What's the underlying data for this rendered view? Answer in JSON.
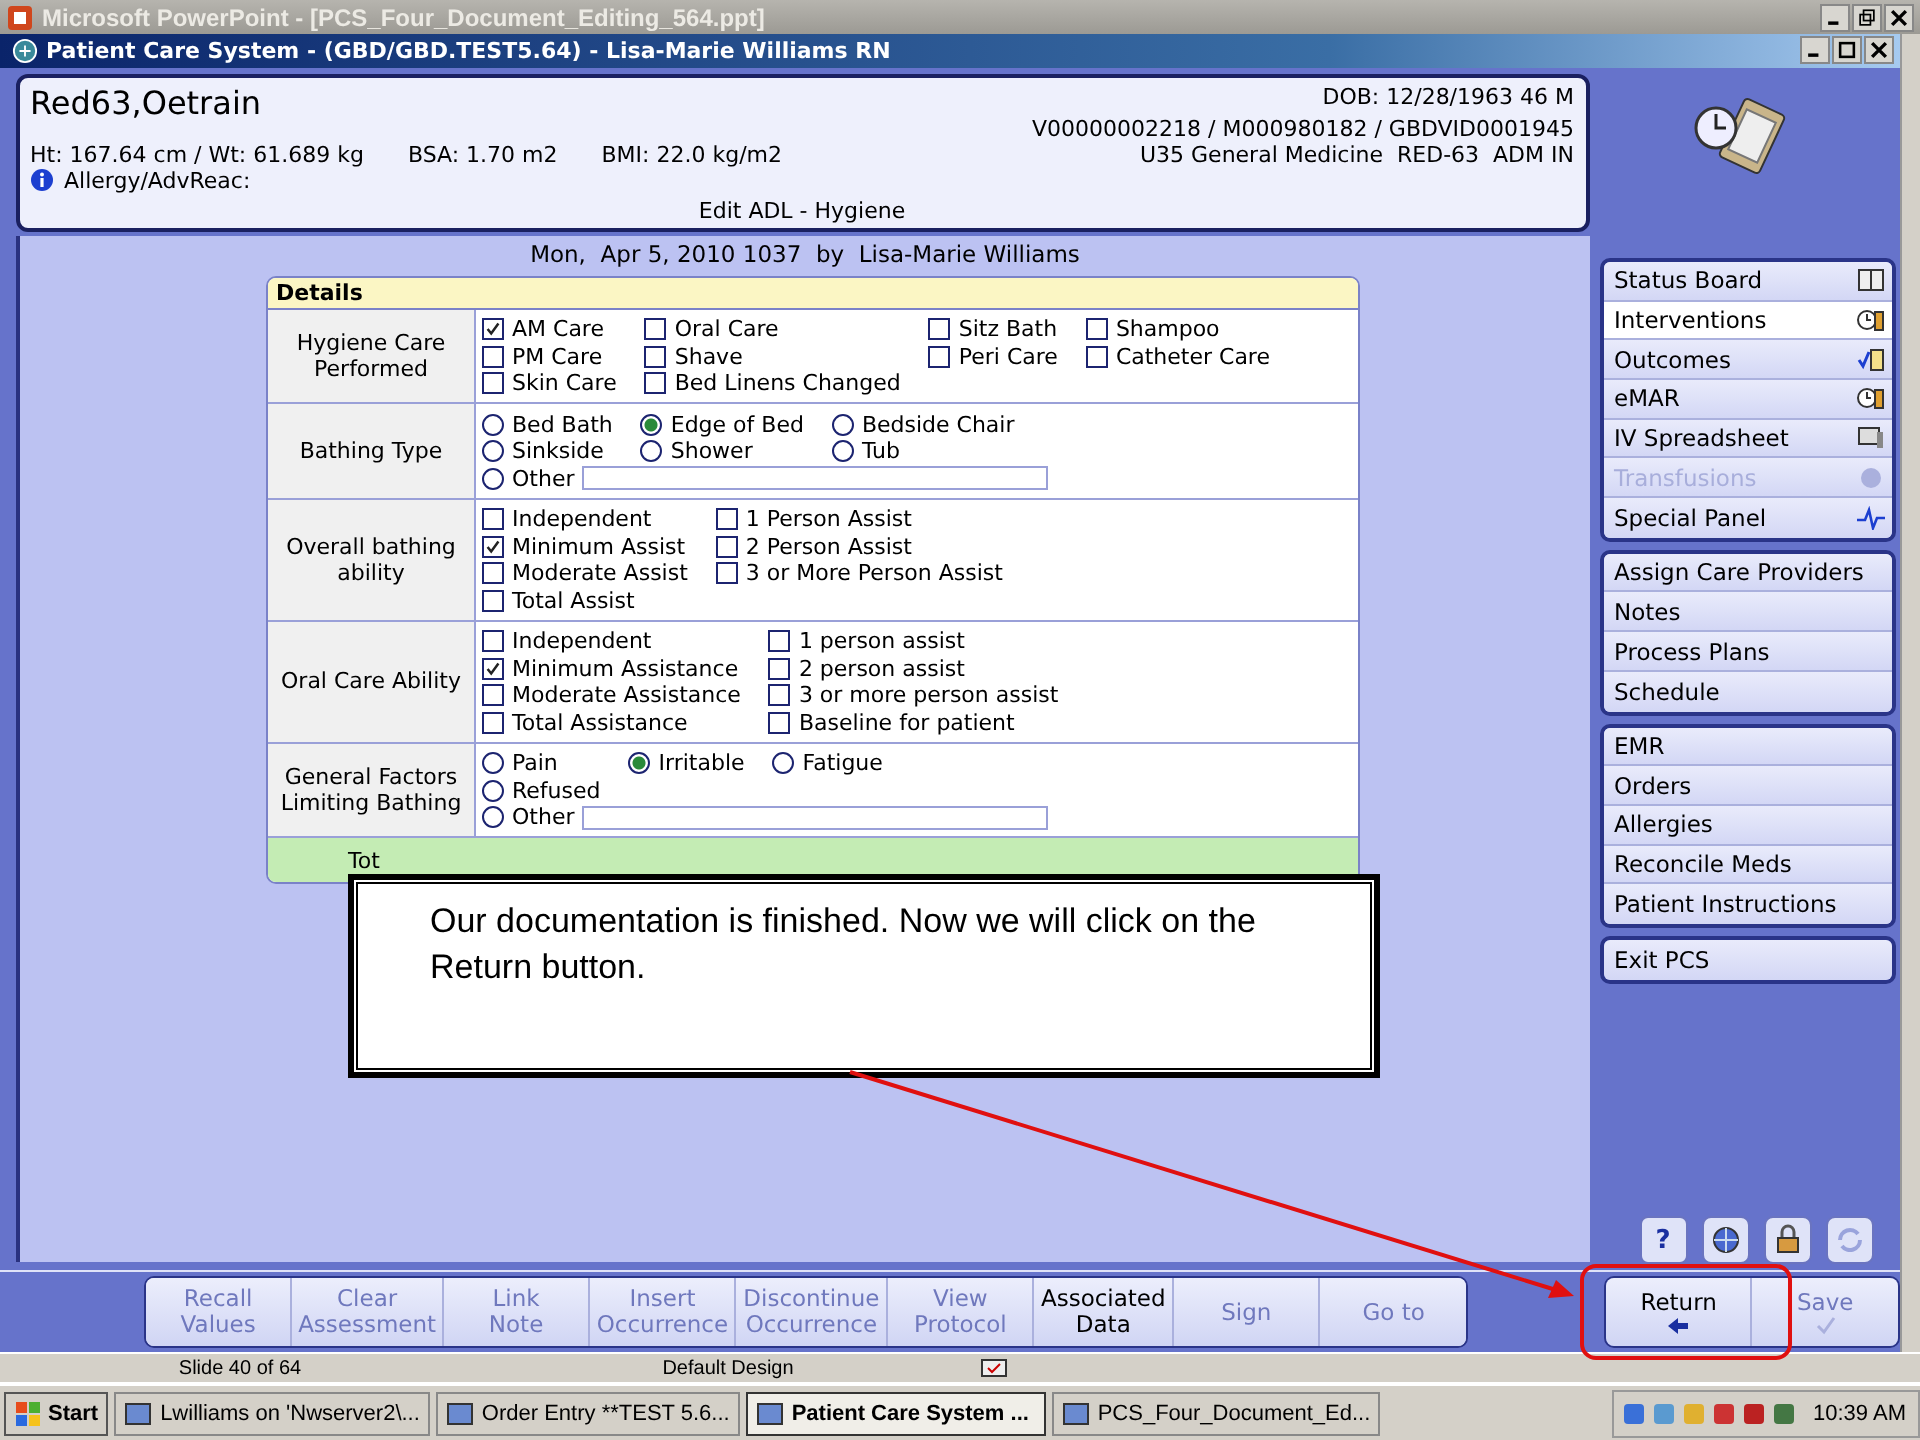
{
  "ppt_window": {
    "title": "Microsoft PowerPoint - [PCS_Four_Document_Editing_564.ppt]"
  },
  "app_window": {
    "title": "Patient Care System - (GBD/GBD.TEST5.64) - Lisa-Marie Williams RN"
  },
  "patient": {
    "name": "Red63,Oetrain",
    "measures": [
      "Ht: 167.64 cm / Wt: 61.689 kg",
      "BSA: 1.70 m2",
      "BMI: 22.0 kg/m2"
    ],
    "allergy": "Allergy/AdvReac:",
    "dob": "DOB: 12/28/1963 46 M",
    "ids": "V00000002218 / M000980182 / GBDVID0001945",
    "unit": "U35 General Medicine  RED-63  ADM IN",
    "form_title": "Edit ADL - Hygiene"
  },
  "entry_line": "Mon,  Apr 5, 2010 1037  by  Lisa-Marie Williams",
  "details": {
    "title": "Details",
    "sections": [
      {
        "label": "Hygiene Care Performed",
        "kind": "checkbox",
        "columns": [
          [
            {
              "label": "AM Care",
              "checked": true
            },
            {
              "label": "PM Care",
              "checked": false
            },
            {
              "label": "Skin Care",
              "checked": false
            }
          ],
          [
            {
              "label": "Oral Care",
              "checked": false
            },
            {
              "label": "Shave",
              "checked": false
            },
            {
              "label": "Bed Linens Changed",
              "checked": false
            }
          ],
          [
            {
              "label": "Sitz Bath",
              "checked": false
            },
            {
              "label": "Peri Care",
              "checked": false
            }
          ],
          [
            {
              "label": "Shampoo",
              "checked": false
            },
            {
              "label": "Catheter Care",
              "checked": false
            }
          ]
        ]
      },
      {
        "label": "Bathing Type",
        "kind": "radio",
        "columns": [
          [
            {
              "label": "Bed Bath",
              "selected": false
            },
            {
              "label": "Sinkside",
              "selected": false
            }
          ],
          [
            {
              "label": "Edge of Bed",
              "selected": true
            },
            {
              "label": "Shower",
              "selected": false
            }
          ],
          [
            {
              "label": "Bedside Chair",
              "selected": false
            },
            {
              "label": "Tub",
              "selected": false
            }
          ]
        ],
        "other": {
          "label": "Other",
          "selected": false
        }
      },
      {
        "label": "Overall bathing ability",
        "kind": "checkbox",
        "columns": [
          [
            {
              "label": "Independent",
              "checked": false
            },
            {
              "label": "Minimum Assist",
              "checked": true
            },
            {
              "label": "Moderate Assist",
              "checked": false
            },
            {
              "label": "Total Assist",
              "checked": false
            }
          ],
          [
            {
              "label": "1 Person Assist",
              "checked": false
            },
            {
              "label": "2 Person Assist",
              "checked": false
            },
            {
              "label": "3 or More Person Assist",
              "checked": false
            }
          ]
        ]
      },
      {
        "label": "Oral Care Ability",
        "kind": "checkbox",
        "columns": [
          [
            {
              "label": "Independent",
              "checked": false
            },
            {
              "label": "Minimum Assistance",
              "checked": true
            },
            {
              "label": "Moderate Assistance",
              "checked": false
            },
            {
              "label": "Total Assistance",
              "checked": false
            }
          ],
          [
            {
              "label": "1 person assist",
              "checked": false
            },
            {
              "label": "2 person assist",
              "checked": false
            },
            {
              "label": "3 or more person assist",
              "checked": false
            },
            {
              "label": "Baseline for patient",
              "checked": false
            }
          ]
        ]
      },
      {
        "label": "General Factors Limiting Bathing",
        "kind": "radio",
        "columns": [
          [
            {
              "label": "Pain",
              "selected": false
            },
            {
              "label": "Refused",
              "selected": false
            }
          ],
          [
            {
              "label": "Irritable",
              "selected": true
            }
          ],
          [
            {
              "label": "Fatigue",
              "selected": false
            }
          ]
        ],
        "other": {
          "label": "Other",
          "selected": false
        }
      }
    ],
    "total_label": "Tot"
  },
  "callout": "Our documentation is finished. Now we will click on the Return button.",
  "sidebar": {
    "groups": [
      [
        {
          "label": "Status Board",
          "selected": false,
          "disabled": false
        },
        {
          "label": "Interventions",
          "selected": true,
          "disabled": false
        },
        {
          "label": "Outcomes",
          "selected": false,
          "disabled": false
        },
        {
          "label": "eMAR",
          "selected": false,
          "disabled": false
        },
        {
          "label": "IV Spreadsheet",
          "selected": false,
          "disabled": false
        },
        {
          "label": "Transfusions",
          "selected": false,
          "disabled": true
        },
        {
          "label": "Special Panel",
          "selected": false,
          "disabled": false
        }
      ],
      [
        {
          "label": "Assign Care Providers",
          "selected": false,
          "disabled": false
        },
        {
          "label": "Notes",
          "selected": false,
          "disabled": false
        },
        {
          "label": "Process Plans",
          "selected": false,
          "disabled": false
        },
        {
          "label": "Schedule",
          "selected": false,
          "disabled": false
        }
      ],
      [
        {
          "label": "EMR",
          "selected": false,
          "disabled": false
        },
        {
          "label": "Orders",
          "selected": false,
          "disabled": false
        },
        {
          "label": "Allergies",
          "selected": false,
          "disabled": false
        },
        {
          "label": "Reconcile Meds",
          "selected": false,
          "disabled": false
        },
        {
          "label": "Patient Instructions",
          "selected": false,
          "disabled": false
        }
      ],
      [
        {
          "label": "Exit PCS",
          "selected": false,
          "disabled": false
        }
      ]
    ],
    "help_label": "?"
  },
  "toolbar": [
    {
      "label": "Recall\nValues",
      "disabled": true
    },
    {
      "label": "Clear\nAssessment",
      "disabled": true
    },
    {
      "label": "Link\nNote",
      "disabled": true
    },
    {
      "label": "Insert\nOccurrence",
      "disabled": true
    },
    {
      "label": "Discontinue\nOccurrence",
      "disabled": true
    },
    {
      "label": "View\nProtocol",
      "disabled": true
    },
    {
      "label": "Associated\nData",
      "disabled": false
    },
    {
      "label": "Sign",
      "disabled": true
    },
    {
      "label": "Go to",
      "disabled": true
    }
  ],
  "actions": [
    {
      "label": "Return",
      "kind": "return",
      "disabled": false
    },
    {
      "label": "Save",
      "kind": "save",
      "disabled": true
    }
  ],
  "ppt_status": [
    "Slide 40 of 64",
    "Default Design"
  ],
  "taskbar": {
    "start": "Start",
    "tasks": [
      {
        "label": "Lwilliams on 'Nwserver2\\...",
        "selected": false
      },
      {
        "label": "Order Entry **TEST 5.6...",
        "selected": false
      },
      {
        "label": "Patient Care System ...",
        "selected": true
      },
      {
        "label": "PCS_Four_Document_Ed...",
        "selected": false
      }
    ],
    "clock": "10:39 AM"
  }
}
